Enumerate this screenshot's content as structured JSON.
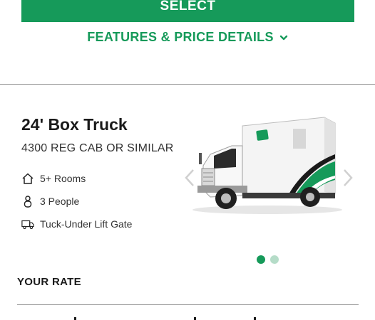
{
  "actions": {
    "select_label": "SELECT",
    "features_link_label": "FEATURES & PRICE DETAILS"
  },
  "vehicle": {
    "name": "24' Box Truck",
    "model": "4300 REG CAB OR SIMILAR",
    "features": [
      {
        "icon": "house-icon",
        "label": "5+ Rooms"
      },
      {
        "icon": "person-icon",
        "label": "3 People"
      },
      {
        "icon": "truck-icon",
        "label": "Tuck-Under Lift Gate"
      }
    ]
  },
  "carousel": {
    "slide_count": 2,
    "active_slide": 1
  },
  "rate": {
    "section_label": "YOUR RATE"
  },
  "colors": {
    "brand_green": "#169a5a",
    "dot_inactive": "#b5dcc8"
  }
}
